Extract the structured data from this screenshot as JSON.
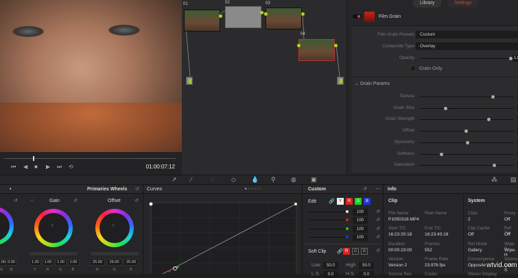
{
  "viewer": {
    "timecode": "01:00:07:12"
  },
  "nodes": [
    {
      "label": "01"
    },
    {
      "label": "02"
    },
    {
      "label": "03"
    },
    {
      "label": "04"
    }
  ],
  "right_panel": {
    "tabs": [
      "Library",
      "Settings"
    ],
    "effect_name": "Film Grain",
    "presets_label": "Film Grain Presets",
    "presets_value": "Custom",
    "composite_label": "Composite Type",
    "composite_value": "Overlay",
    "opacity_label": "Opacity",
    "opacity_value": "1.0",
    "opacity_fraction": 0.99,
    "grain_only_label": "Grain Only",
    "section": "Grain Params",
    "params": [
      {
        "label": "Texture",
        "value": "0.7",
        "fraction": 0.78
      },
      {
        "label": "Grain Size",
        "value": "0.2",
        "fraction": 0.27
      },
      {
        "label": "Grain Strength",
        "value": "0.7",
        "fraction": 0.73
      },
      {
        "label": "Offset",
        "value": "0.4",
        "fraction": 0.49
      },
      {
        "label": "Symmetry",
        "value": "0.5",
        "fraction": 0.5
      },
      {
        "label": "Softness",
        "value": "0.2",
        "fraction": 0.22
      },
      {
        "label": "Saturation",
        "value": "0.7",
        "fraction": 0.79
      }
    ]
  },
  "wheels": {
    "mode": "Primaries Wheels",
    "left_values": [
      "0.00",
      "0.00"
    ],
    "left_channels": [
      "G",
      "B"
    ],
    "gain": {
      "title": "Gain",
      "values": [
        "1.00",
        "1.00",
        "1.00",
        "1.00"
      ],
      "channels": [
        "Y",
        "R",
        "G",
        "B"
      ]
    },
    "offset": {
      "title": "Offset",
      "values": [
        "25.00",
        "25.00",
        "25.00"
      ],
      "channels": [
        "R",
        "G",
        "B"
      ]
    }
  },
  "curves": {
    "title": "Curves",
    "mode": "Custom"
  },
  "edit": {
    "title": "Edit",
    "channels": [
      "Y",
      "R",
      "G",
      "B"
    ],
    "values": [
      "100",
      "100",
      "100",
      "100"
    ],
    "soft_clip": "Soft Clip",
    "soft_channels": [
      "R",
      "G",
      "B"
    ],
    "low_label": "Low",
    "low_value": "50.0",
    "high_label": "High",
    "high_value": "50.0",
    "ls_label": "L.S.",
    "ls_value": "0.0",
    "hs_label": "H.S.",
    "hs_value": "0.0"
  },
  "info": {
    "title": "Info",
    "clip_heading": "Clip",
    "system_heading": "System",
    "clip": [
      {
        "k": "File Name",
        "v": "P1050318.MP4"
      },
      {
        "k": "Reel Name",
        "v": ""
      },
      {
        "k": "Start T/C",
        "v": "16:23:20:18"
      },
      {
        "k": "End T/C",
        "v": "16:23:43:18"
      },
      {
        "k": "Duration",
        "v": "00:00:23:00"
      },
      {
        "k": "Frames",
        "v": "552"
      },
      {
        "k": "Version",
        "v": "Version 2"
      },
      {
        "k": "Frame Rate",
        "v": "23.976 fps"
      },
      {
        "k": "Source Res",
        "v": ""
      },
      {
        "k": "Codec",
        "v": ""
      }
    ],
    "system": [
      {
        "k": "Clips",
        "v": "2"
      },
      {
        "k": "Proxy",
        "v": "Off"
      },
      {
        "k": "Clip Cache",
        "v": "Off"
      },
      {
        "k": "Ref Tra",
        "v": "Off"
      },
      {
        "k": "Ref Mode",
        "v": "Gallery"
      },
      {
        "k": "Wipe S",
        "v": "Wipe-H"
      },
      {
        "k": "Convergence",
        "v": "Opposite"
      },
      {
        "k": "Stereo",
        "v": "Left - S"
      },
      {
        "k": "Stereo Display",
        "v": ""
      },
      {
        "k": "",
        "v": ""
      }
    ]
  },
  "watermark": "wtvid.com"
}
